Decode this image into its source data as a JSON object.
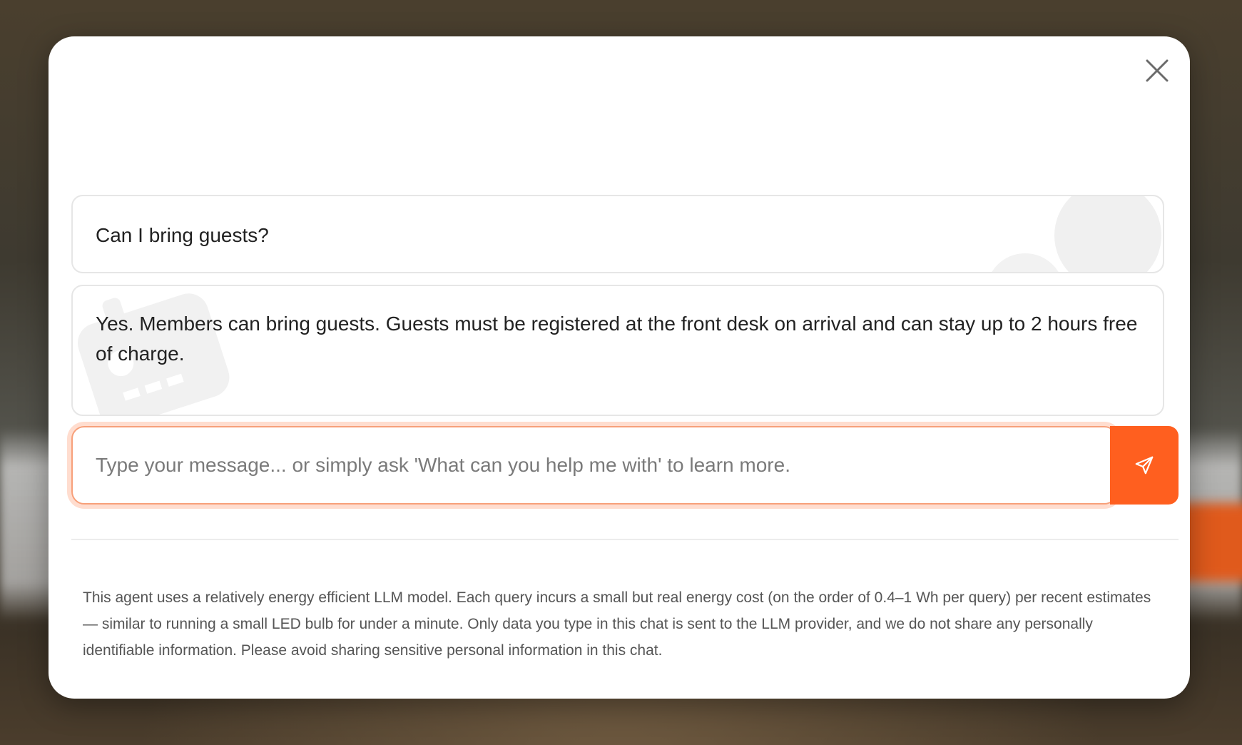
{
  "modal": {
    "close_label": "Close"
  },
  "messages": [
    {
      "role": "user",
      "text": "Can I bring guests?"
    },
    {
      "role": "assistant",
      "text": "Yes. Members can bring guests. Guests must be registered at the front desk on arrival and can stay up to 2 hours free of charge."
    }
  ],
  "input": {
    "value": "",
    "placeholder": "Type your message... or simply ask 'What can you help me with' to learn more."
  },
  "send_button": {
    "icon": "send-icon"
  },
  "disclaimer": "This agent uses a relatively energy efficient LLM model. Each query incurs a small but real energy cost (on the order of 0.4–1 Wh per query) per recent estimates — similar to running a small LED bulb for under a minute. Only data you type in this chat is sent to the LLM provider, and we do not share any personally identifiable information. Please avoid sharing sensitive personal information in this chat.",
  "colors": {
    "accent": "#ff5f1f",
    "bubble_border": "#e6e6e6",
    "text": "#222222",
    "muted_text": "#555555"
  }
}
